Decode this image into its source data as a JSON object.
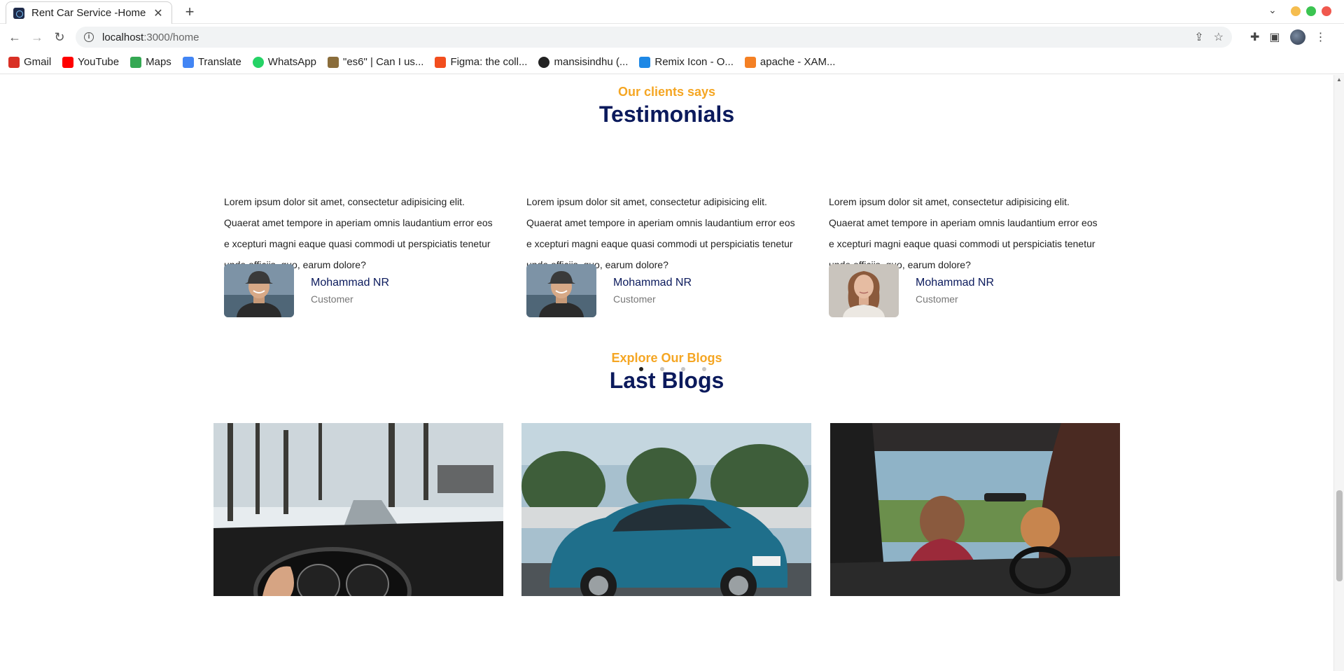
{
  "browser": {
    "tab_title": "Rent Car Service -Home",
    "url_host": "localhost",
    "url_path": ":3000/home",
    "bookmarks": [
      {
        "label": "Gmail",
        "color": "#d93025"
      },
      {
        "label": "YouTube",
        "color": "#ff0000"
      },
      {
        "label": "Maps",
        "color": "#34a853"
      },
      {
        "label": "Translate",
        "color": "#4285f4"
      },
      {
        "label": "WhatsApp",
        "color": "#25d366"
      },
      {
        "label": "\"es6\" | Can I us...",
        "color": "#8a6d3b"
      },
      {
        "label": "Figma: the coll...",
        "color": "#f24e1e"
      },
      {
        "label": "mansisindhu (...",
        "color": "#222222"
      },
      {
        "label": "Remix Icon - O...",
        "color": "#1e88e5"
      },
      {
        "label": "apache - XAM...",
        "color": "#f48024"
      }
    ]
  },
  "testimonials": {
    "subtitle": "Our clients says",
    "title": "Testimonials",
    "items": [
      {
        "quote": "Lorem ipsum dolor sit amet, consectetur adipisicing elit. Quaerat amet tempore in aperiam omnis laudantium error eos e xcepturi magni eaque quasi commodi ut perspiciatis tenetur unde officiis, quo, earum dolore?",
        "name": "Mohammad NR",
        "role": "Customer",
        "photo": "man"
      },
      {
        "quote": "Lorem ipsum dolor sit amet, consectetur adipisicing elit. Quaerat amet tempore in aperiam omnis laudantium error eos e xcepturi magni eaque quasi commodi ut perspiciatis tenetur unde officiis, quo, earum dolore?",
        "name": "Mohammad NR",
        "role": "Customer",
        "photo": "man"
      },
      {
        "quote": "Lorem ipsum dolor sit amet, consectetur adipisicing elit. Quaerat amet tempore in aperiam omnis laudantium error eos e xcepturi magni eaque quasi commodi ut perspiciatis tenetur unde officiis, quo, earum dolore?",
        "name": "Mohammad NR",
        "role": "Customer",
        "photo": "woman"
      }
    ],
    "carousel": {
      "page_count": 4,
      "active_page": 1
    }
  },
  "blogs": {
    "subtitle": "Explore Our Blogs",
    "title": "Last Blogs",
    "cards": [
      {
        "image": "snowy-road-driving"
      },
      {
        "image": "blue-hatchback-car"
      },
      {
        "image": "convertible-road-trip"
      }
    ]
  },
  "colors": {
    "accent": "#f5a623",
    "heading": "#0b1a5c"
  }
}
